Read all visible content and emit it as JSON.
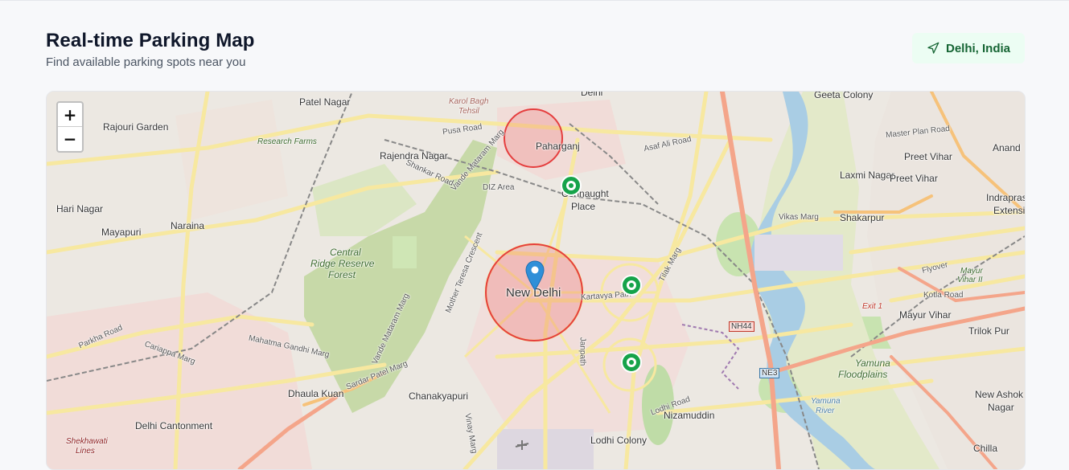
{
  "header": {
    "title": "Real-time Parking Map",
    "subtitle": "Find available parking spots near you",
    "location_label": "Delhi, India"
  },
  "map": {
    "zoom_in": "+",
    "zoom_out": "−",
    "places": {
      "patel_nagar": "Patel Nagar",
      "karol_bagh": "Karol Bagh",
      "tehsil": "Tehsil",
      "delhi": "Delhi",
      "geeta_colony": "Geeta Colony",
      "rajouri_garden": "Rajouri Garden",
      "paharganj": "Paharganj",
      "research_farms": "Research Farms",
      "rajendra_nagar": "Rajendra Nagar",
      "hari_nagar": "Hari Nagar",
      "mayapuri": "Mayapuri",
      "naraina": "Naraina",
      "connaught": "Connaught",
      "place": "Place",
      "laxmi_nagar": "Laxmi Nagar",
      "preet_vihar_1": "Preet Vihar",
      "preet_vihar_2": "Preet Vihar",
      "anand": "Anand",
      "indraprastha": "Indraprastha",
      "extension": "Extension",
      "shakarpur": "Shakarpur",
      "central_ridge": "Central",
      "ridge_reserve": "Ridge Reserve",
      "forest": "Forest",
      "new_delhi": "New Delhi",
      "mayur_vihar": "Mayur Vihar",
      "trilok_pur": "Trilok Pur",
      "yamuna_floodplains_1": "Yamuna",
      "yamuna_floodplains_2": "Floodplains",
      "dhaula_kuan": "Dhaula Kuan",
      "chanakyapuri": "Chanakyapuri",
      "nizamuddin": "Nizamuddin",
      "new_ashok_1": "New Ashok",
      "new_ashok_2": "Nagar",
      "delhi_cantonment": "Delhi Cantonment",
      "lodhi_colony": "Lodhi Colony",
      "chilla": "Chilla",
      "yamuna_river_1": "Yamuna",
      "yamuna_river_2": "River",
      "shekhawati_1": "Shekhawati",
      "shekhawati_2": "Lines",
      "mayur_vihar_ii_1": "Mayur",
      "mayur_vihar_ii_2": "Vihar II"
    },
    "roads": {
      "pusa_road": "Pusa Road",
      "asaf_ali": "Asaf Ali Road",
      "vikas_marg": "Vikas Marg",
      "master_plan": "Master Plan Road",
      "shankar_road": "Shankar Road",
      "diz_area": "DIZ Area",
      "kartavya_path": "Kartavya Path",
      "parkha_road": "Parkha Road",
      "cariappa_marg": "Cariappa Marg",
      "mahatma_gandhi_marg": "Mahatma Gandhi Marg",
      "sardar_patel_marg": "Sardar Patel Marg",
      "nh44": "NH44",
      "ne3": "NE3",
      "exit1": "Exit 1",
      "flyover": "Flyover",
      "kotla_road": "Kotla Road",
      "lodhi_road": "Lodhi Road",
      "janpath": "Janpath",
      "tilak_marg": "Tilak Marg",
      "vinay_marg": "Vinay Marg",
      "mother_teresa": "Mother Teresa Crescent",
      "vande_mataram": "Vande Mataram Marg",
      "shankar_marg": "Vande Mataram Marg"
    },
    "zones": [
      {
        "name": "paharganj-zone",
        "status": "busy"
      },
      {
        "name": "new-delhi-zone",
        "status": "busy"
      }
    ],
    "spots": [
      {
        "name": "connaught-place-spot",
        "status": "available"
      },
      {
        "name": "kartavya-path-spot",
        "status": "available"
      },
      {
        "name": "lodhi-garden-spot",
        "status": "available"
      }
    ],
    "colors": {
      "available": "#16a34a",
      "busy": "#ef4444",
      "pin": "#2f8fd8"
    }
  }
}
